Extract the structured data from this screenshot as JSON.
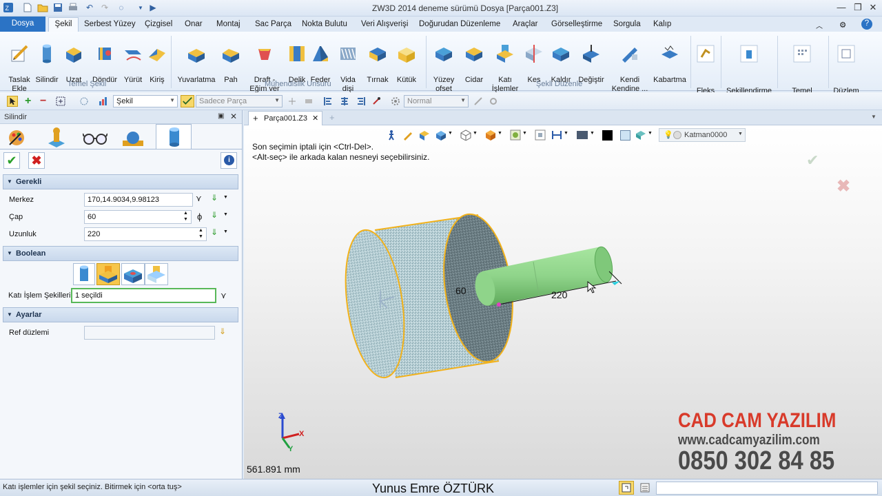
{
  "window": {
    "title": "ZW3D 2014 deneme sürümü       Dosya [Parça001.Z3]",
    "controls": [
      "—",
      "❐",
      "✕"
    ]
  },
  "menu": {
    "file": "Dosya",
    "tabs": [
      "Şekil",
      "Serbest Yüzey",
      "Çizgisel",
      "Onar",
      "Montaj",
      "Sac Parça",
      "Nokta Bulutu",
      "Veri Alışverişi",
      "Doğurudan Düzenleme",
      "Araçlar",
      "Görselleştirme",
      "Sorgula",
      "Kalıp"
    ]
  },
  "ribbon": {
    "buttons": [
      {
        "label": "Taslak\nEkle",
        "icon": "sketch-icon"
      },
      {
        "label": "Silindir",
        "icon": "cylinder-icon"
      },
      {
        "label": "Uzat",
        "icon": "extrude-icon"
      },
      {
        "label": "Döndür",
        "icon": "revolve-icon"
      },
      {
        "label": "Yürüt",
        "icon": "sweep-icon"
      },
      {
        "label": "Kiriş",
        "icon": "loft-icon"
      },
      {
        "label": "Yuvarlatma",
        "icon": "fillet-icon"
      },
      {
        "label": "Pah",
        "icon": "chamfer-icon"
      },
      {
        "label": "Draft -\nEğim ver",
        "icon": "draft-icon"
      },
      {
        "label": "Delik",
        "icon": "hole-icon"
      },
      {
        "label": "Feder",
        "icon": "rib-icon"
      },
      {
        "label": "Vida\ndişi",
        "icon": "thread-icon"
      },
      {
        "label": "Tırnak",
        "icon": "lip-icon"
      },
      {
        "label": "Kütük",
        "icon": "stock-icon"
      },
      {
        "label": "Yüzey\nofset",
        "icon": "face-offset-icon"
      },
      {
        "label": "Cidar",
        "icon": "shell-icon"
      },
      {
        "label": "Katı\nİşlemler",
        "icon": "boolean-icon"
      },
      {
        "label": "Kes",
        "icon": "cut-icon"
      },
      {
        "label": "Kaldır",
        "icon": "remove-icon"
      },
      {
        "label": "Değiştir",
        "icon": "replace-icon"
      },
      {
        "label": "Kendi\nKendine ...",
        "icon": "self-icon"
      },
      {
        "label": "Kabartma",
        "icon": "emboss-icon"
      },
      {
        "label": "Fleks",
        "icon": "flex-icon"
      },
      {
        "label": "Şekillendirme",
        "icon": "morph-icon"
      },
      {
        "label": "Temel\nDüzenleme",
        "icon": "basic-edit-icon"
      },
      {
        "label": "Düzlem",
        "icon": "plane-icon"
      }
    ],
    "groups": [
      "Temel Şekil",
      "Mühendislik Unsuru",
      "Şekli Düzenle"
    ]
  },
  "toolbar": {
    "filter_value": "Şekil",
    "part_value": "Sadece Parça",
    "mode_value": "Normal"
  },
  "panel": {
    "title": "Silindir",
    "sections": {
      "required": "Gerekli",
      "boolean": "Boolean",
      "settings": "Ayarlar"
    },
    "fields": {
      "center_label": "Merkez",
      "center_value": "170,14.9034,9.98123",
      "diameter_label": "Çap",
      "diameter_value": "60",
      "diameter_symbol": "ϕ",
      "length_label": "Uzunluk",
      "length_value": "220",
      "solid_label": "Katı İşlem Şekilleri",
      "solid_value": "1 seçildi",
      "ref_label": "Ref düzlemi",
      "ref_value": ""
    }
  },
  "document": {
    "tab_label": "Parça001.Z3",
    "layer": "Katman0000",
    "hint_line1": "Son seçimin iptali için <Ctrl-Del>.",
    "hint_line2": "<Alt-seç> ile arkada kalan nesneyi seçebilirsiniz.",
    "dim_diameter": "60",
    "dim_length": "220",
    "scale_readout": "561.891 mm",
    "axis_x": "X",
    "axis_y": "Y",
    "axis_z": "Z"
  },
  "watermark": {
    "brand": "CAD CAM YAZILIM",
    "url": "www.cadcamyazilim.com",
    "phone": "0850 302 84 85"
  },
  "status": {
    "message": "Katı işlemler için şekil seçiniz.  Bitirmek için  <orta tuş>",
    "author": "Yunus Emre ÖZTÜRK"
  },
  "colors": {
    "accent": "#2b73c5",
    "green_cylinder": "#8fd48a",
    "body_cylinder": "#a8c4cc",
    "edge_orange": "#f2b21b",
    "watermark_red": "#d83a2a",
    "watermark_gray": "#4a4a4a"
  }
}
